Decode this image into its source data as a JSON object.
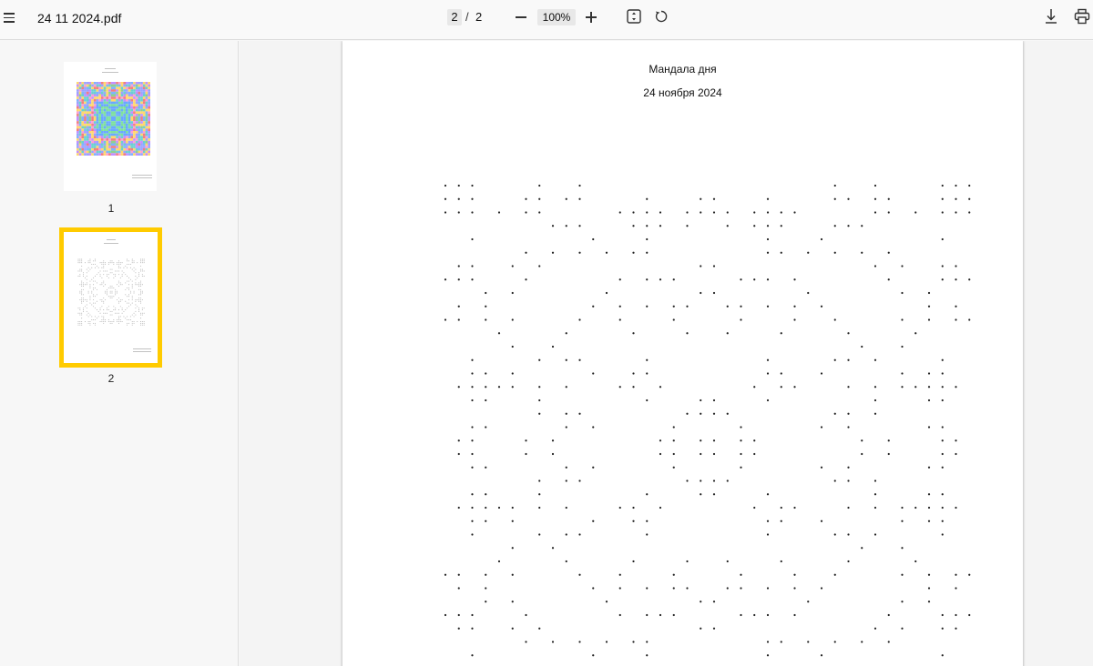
{
  "toolbar": {
    "file_name": "24 11 2024.pdf",
    "current_page": "2",
    "page_separator": "/",
    "total_pages": "2",
    "zoom": "100%"
  },
  "icons": {
    "menu": "hamburger-menu-icon",
    "zoom_out": "minus-icon",
    "zoom_in": "plus-icon",
    "fit": "fit-page-icon",
    "rotate": "rotate-icon",
    "download": "download-icon",
    "print": "print-icon"
  },
  "thumbnails": [
    {
      "label": "1",
      "selected": false
    },
    {
      "label": "2",
      "selected": true
    }
  ],
  "document": {
    "title": "Мандала дня",
    "date": "24 ноября 2024"
  },
  "colors": {
    "selection": "#ffcb00",
    "toolbar_bg": "#f9f9f9",
    "page_bg": "#ffffff"
  }
}
